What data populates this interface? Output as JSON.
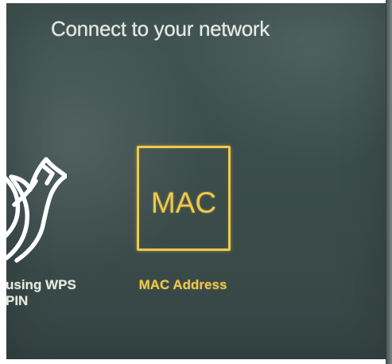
{
  "header": {
    "title": "Connect to your network"
  },
  "options": [
    {
      "icon": "wps-arrow-icon",
      "label": "using WPS\nPIN",
      "selected": false
    },
    {
      "tile_text": "MAC",
      "label": "MAC Address",
      "selected": true
    }
  ],
  "colors": {
    "background": "#3c4e4c",
    "text": "#f0f0ea",
    "accent": "#f1c84b"
  }
}
